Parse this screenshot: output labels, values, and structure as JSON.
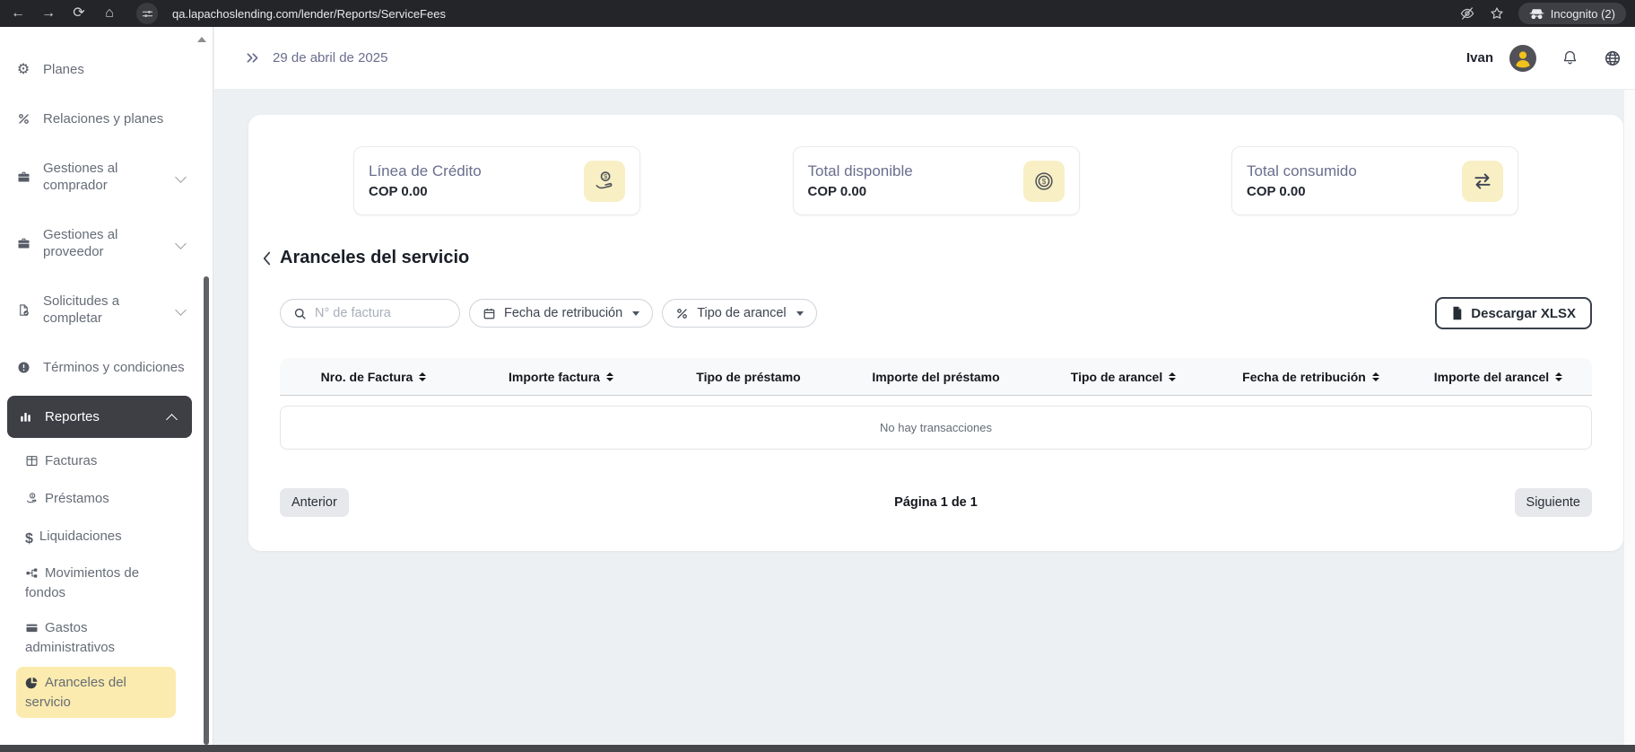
{
  "browser": {
    "url": "qa.lapachoslending.com/lender/Reports/ServiceFees",
    "incognito_label": "Incognito (2)"
  },
  "header": {
    "date": "29 de abril de 2025",
    "user_name": "Ivan"
  },
  "sidebar": {
    "items": [
      {
        "label": "Planes",
        "icon": "gear-icon"
      },
      {
        "label": "Relaciones y planes",
        "icon": "percent-icon"
      },
      {
        "label": "Gestiones al comprador",
        "icon": "briefcase-icon",
        "expandable": true
      },
      {
        "label": "Gestiones al proveedor",
        "icon": "briefcase-icon",
        "expandable": true
      },
      {
        "label": "Solicitudes a completar",
        "icon": "document-check-icon",
        "expandable": true
      },
      {
        "label": "Términos y condiciones",
        "icon": "alert-circle-icon"
      },
      {
        "label": "Reportes",
        "icon": "bar-chart-icon",
        "expandable": true,
        "expanded": true,
        "active": true
      }
    ],
    "report_subitems": [
      {
        "label": "Facturas",
        "icon": "table-icon"
      },
      {
        "label": "Préstamos",
        "icon": "hand-coin-icon"
      },
      {
        "label": "Liquidaciones",
        "icon": "dollar-icon"
      },
      {
        "label": "Movimientos de fondos",
        "icon": "network-icon"
      },
      {
        "label": "Gastos administrativos",
        "icon": "wallet-icon"
      },
      {
        "label": "Aranceles del servicio",
        "icon": "pie-chart-icon",
        "active": true
      }
    ]
  },
  "cards": [
    {
      "title": "Línea de Crédito",
      "value": "COP 0.00",
      "icon": "hand-coin-icon"
    },
    {
      "title": "Total disponible",
      "value": "COP 0.00",
      "icon": "coins-icon"
    },
    {
      "title": "Total consumido",
      "value": "COP 0.00",
      "icon": "transfer-arrows-icon"
    }
  ],
  "page": {
    "title": "Aranceles del servicio"
  },
  "filters": {
    "search_placeholder": "N° de factura",
    "date_filter": "Fecha de retribución",
    "type_filter": "Tipo de arancel",
    "download_button": "Descargar XLSX"
  },
  "table": {
    "columns": [
      {
        "label": "Nro. de Factura",
        "sortable": true
      },
      {
        "label": "Importe factura",
        "sortable": true
      },
      {
        "label": "Tipo de préstamo",
        "sortable": false
      },
      {
        "label": "Importe del préstamo",
        "sortable": false
      },
      {
        "label": "Tipo de arancel",
        "sortable": true
      },
      {
        "label": "Fecha de retribución",
        "sortable": true
      },
      {
        "label": "Importe del arancel",
        "sortable": true
      }
    ],
    "rows": [],
    "empty_message": "No hay transacciones"
  },
  "pagination": {
    "previous": "Anterior",
    "status": "Página 1 de 1",
    "next": "Siguiente"
  },
  "colors": {
    "accent_yellow": "#FBEBAE",
    "card_icon_bg": "#F8EFC5",
    "active_dark": "#3E3E45",
    "title_purple": "#6A6E8D",
    "content_bg": "#EDF0F2"
  }
}
